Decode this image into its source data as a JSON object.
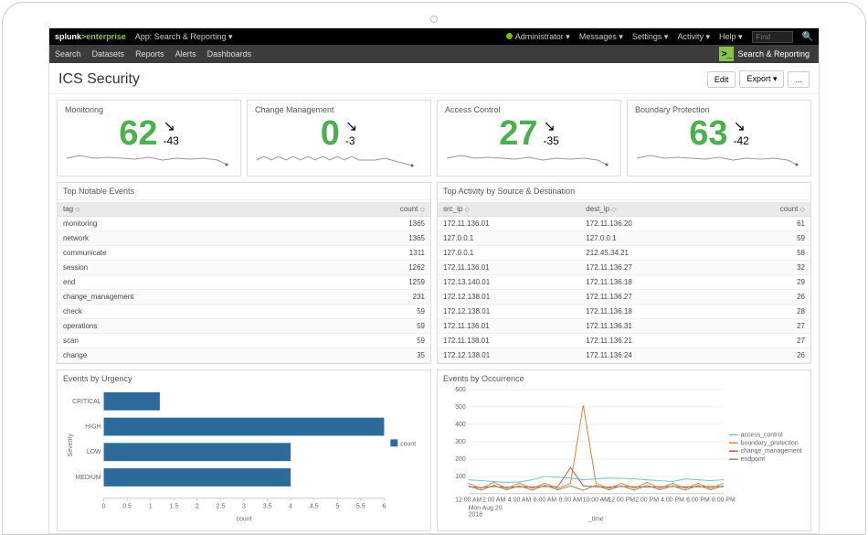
{
  "topbar": {
    "brand_a": "splunk",
    "brand_b": ">enterprise",
    "app_label": "App: Search & Reporting",
    "admin": "Administrator",
    "items": [
      "Messages",
      "Settings",
      "Activity",
      "Help"
    ],
    "find_placeholder": "Find"
  },
  "navbar": {
    "items": [
      "Search",
      "Datasets",
      "Reports",
      "Alerts",
      "Dashboards"
    ],
    "sr_label": "Search & Reporting"
  },
  "page_title": "ICS Security",
  "buttons": {
    "edit": "Edit",
    "export": "Export",
    "more": "..."
  },
  "kpis": [
    {
      "title": "Monitoring",
      "value": "62",
      "delta": "-43"
    },
    {
      "title": "Change Management",
      "value": "0",
      "delta": "-3"
    },
    {
      "title": "Access Control",
      "value": "27",
      "delta": "-35"
    },
    {
      "title": "Boundary Protection",
      "value": "63",
      "delta": "-42"
    }
  ],
  "table_left": {
    "title": "Top Notable Events",
    "cols": [
      "tag",
      "count"
    ],
    "rows": [
      [
        "monitoring",
        "1365"
      ],
      [
        "network",
        "1365"
      ],
      [
        "communicate",
        "1311"
      ],
      [
        "session",
        "1262"
      ],
      [
        "end",
        "1259"
      ],
      [
        "change_management",
        "231"
      ],
      [
        "check",
        "59"
      ],
      [
        "operations",
        "59"
      ],
      [
        "scan",
        "59"
      ],
      [
        "change",
        "35"
      ]
    ]
  },
  "table_right": {
    "title": "Top Activity by Source & Destination",
    "cols": [
      "src_ip",
      "dest_ip",
      "count"
    ],
    "rows": [
      [
        "172.11.136.01",
        "172.11.136.20",
        "61"
      ],
      [
        "127.0.0.1",
        "127.0.0.1",
        "59"
      ],
      [
        "127.0.0.1",
        "212.45.34.21",
        "58"
      ],
      [
        "172.11.136.01",
        "172.11.136.27",
        "32"
      ],
      [
        "172.13.140.01",
        "172.11.136.18",
        "29"
      ],
      [
        "172.12.138.01",
        "172.11.136.27",
        "26"
      ],
      [
        "172.12.138.01",
        "172.11.136.18",
        "28"
      ],
      [
        "172.11.136.01",
        "172.11.136.31",
        "27"
      ],
      [
        "172.11.138.01",
        "172.11.136.21",
        "27"
      ],
      [
        "172.12.138.01",
        "172.11.136.24",
        "26"
      ]
    ]
  },
  "chart_urgency": {
    "title": "Events by Urgency",
    "xlabel": "count",
    "ylabel": "Severity",
    "legend": "count"
  },
  "chart_occurrence": {
    "title": "Events by Occurrence",
    "xlabel": "_time",
    "date_line1": "Mon Aug 20",
    "date_line2": "2018",
    "legend": [
      "access_control",
      "boundary_protection",
      "change_management",
      "endpoint"
    ]
  },
  "chart_data": [
    {
      "type": "bar",
      "orientation": "horizontal",
      "title": "Events by Urgency",
      "xlabel": "count",
      "ylabel": "Severity",
      "categories": [
        "CRITICAL",
        "HIGH",
        "LOW",
        "MEDIUM"
      ],
      "values": [
        1.2,
        6.0,
        4.0,
        4.0
      ],
      "xlim": [
        0,
        6
      ],
      "xticks": [
        0,
        0.5,
        1.0,
        1.5,
        2.0,
        2.5,
        3.0,
        3.5,
        4.0,
        4.5,
        5.0,
        5.5,
        6.0
      ],
      "series_name": "count"
    },
    {
      "type": "line",
      "title": "Events by Occurrence",
      "xlabel": "_time",
      "x_ticks": [
        "12:00 AM",
        "2:00 AM",
        "4:00 AM",
        "6:00 AM",
        "8:00 AM",
        "10:00 AM",
        "12:00 PM",
        "2:00 PM",
        "4:00 PM",
        "6:00 PM",
        "8:00 PM"
      ],
      "date": "Mon Aug 20 2018",
      "ylim": [
        0,
        600
      ],
      "yticks": [
        100,
        200,
        300,
        400,
        500,
        600
      ],
      "series": [
        {
          "name": "access_control",
          "color": "#6ec1c8",
          "values": [
            80,
            75,
            70,
            65,
            68,
            80,
            100,
            95,
            90,
            80,
            85,
            90,
            88,
            85,
            80,
            75,
            70,
            85,
            80,
            75,
            80
          ]
        },
        {
          "name": "boundary_protection",
          "color": "#e27f3a",
          "values": [
            60,
            30,
            65,
            30,
            60,
            30,
            60,
            30,
            60,
            510,
            60,
            30,
            60,
            30,
            65,
            30,
            60,
            30,
            60,
            30,
            60
          ]
        },
        {
          "name": "change_management",
          "color": "#b45c48",
          "values": [
            40,
            35,
            42,
            36,
            40,
            38,
            42,
            40,
            150,
            45,
            40,
            38,
            42,
            40,
            38,
            40,
            42,
            38,
            40,
            42,
            40
          ]
        },
        {
          "name": "endpoint",
          "color": "#8a8f57",
          "values": [
            45,
            20,
            48,
            22,
            45,
            20,
            48,
            22,
            45,
            20,
            48,
            22,
            45,
            20,
            48,
            22,
            45,
            20,
            48,
            22,
            45
          ]
        }
      ]
    }
  ]
}
